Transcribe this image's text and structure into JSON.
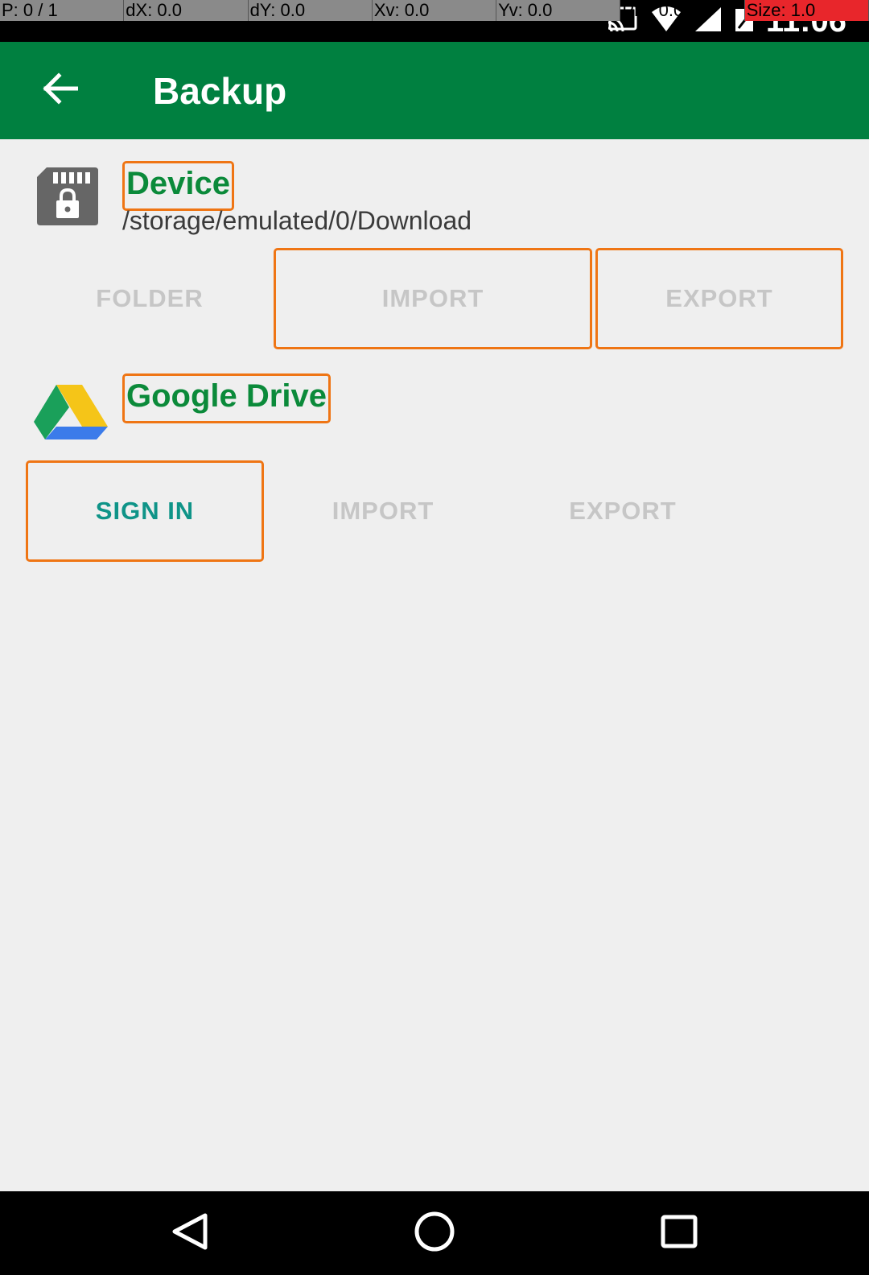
{
  "pointer_overlay": {
    "p": "P: 0 / 1",
    "dx": "dX: 0.0",
    "dy": "dY: 0.0",
    "xv": "Xv: 0.0",
    "yv": "Yv: 0.0",
    "prs": "Prs: 0.0",
    "size": "Size: 1.0"
  },
  "status_bar": {
    "time": "11:06",
    "icons": [
      "cast-icon",
      "wifi-icon",
      "signal-icon",
      "battery-icon"
    ]
  },
  "app_bar": {
    "title": "Backup",
    "background": "#008040",
    "back_icon": "arrow-back-icon"
  },
  "device_section": {
    "title": "Device",
    "path": "/storage/emulated/0/Download",
    "icon": "sd-card-lock-icon",
    "buttons": {
      "folder": "FOLDER",
      "import": "IMPORT",
      "export": "EXPORT"
    }
  },
  "drive_section": {
    "title": "Google Drive",
    "icon": "google-drive-icon",
    "buttons": {
      "sign_in": "SIGN IN",
      "import": "IMPORT",
      "export": "EXPORT"
    }
  },
  "nav_bar": {
    "buttons": [
      "back-icon",
      "home-icon",
      "recents-icon"
    ]
  },
  "colors": {
    "accent": "#0f9488",
    "title_green": "#0b8a3a",
    "disabled": "#c6c6c6",
    "highlight": "#ef7514"
  }
}
